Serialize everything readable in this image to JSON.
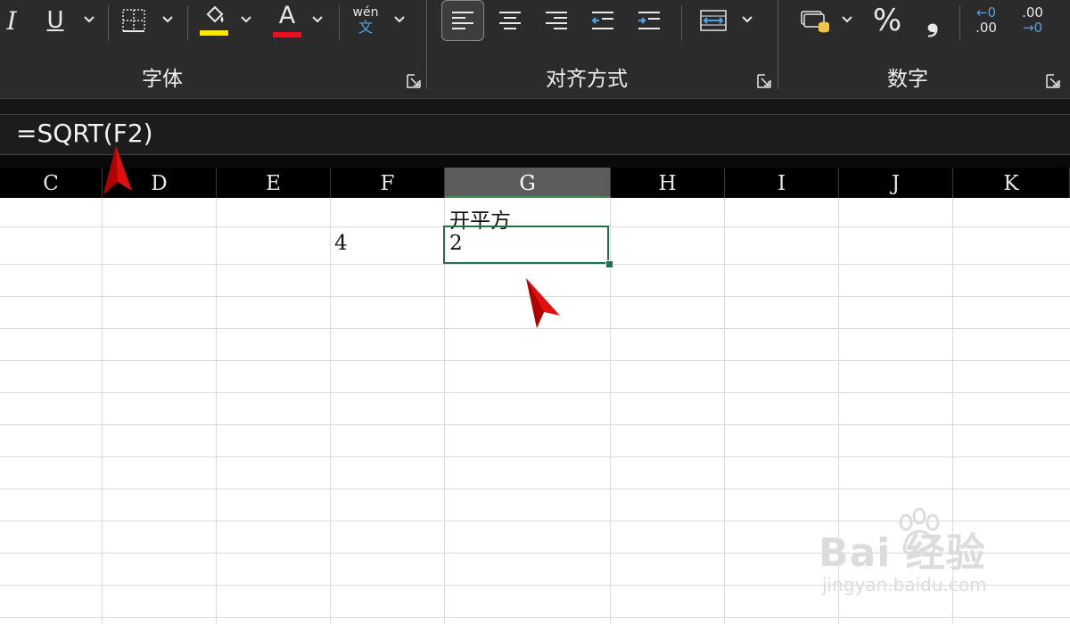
{
  "ribbon": {
    "groups": [
      {
        "label": "字体"
      },
      {
        "label": "对齐方式"
      },
      {
        "label": "数字"
      }
    ],
    "italic_glyph": "I",
    "underline_glyph": "U",
    "font_color_glyph": "A",
    "phonetic": {
      "top": "wén",
      "bottom": "文"
    },
    "percent_glyph": "%",
    "comma_glyph": "❟",
    "decimal_increase": {
      "top": "←0",
      "bottom": ".00"
    },
    "decimal_decrease": {
      "top": ".00",
      "bottom": "→0"
    },
    "fill_color": "#ffe600",
    "font_color": "#e81123"
  },
  "formula_bar": {
    "formula": "=SQRT(F2)"
  },
  "sheet": {
    "columns": [
      "C",
      "D",
      "E",
      "F",
      "G",
      "H",
      "I",
      "J",
      "K"
    ],
    "selected_column": "G",
    "cells": {
      "G1": "开平方",
      "F2": "4",
      "G2": "2"
    }
  },
  "watermark": {
    "brand": "Bai 经验",
    "url": "jingyan.baidu.com"
  },
  "colors": {
    "ribbon_bg": "#2b2b2b",
    "selection_green": "#217346",
    "annotation_red": "#e01010"
  }
}
